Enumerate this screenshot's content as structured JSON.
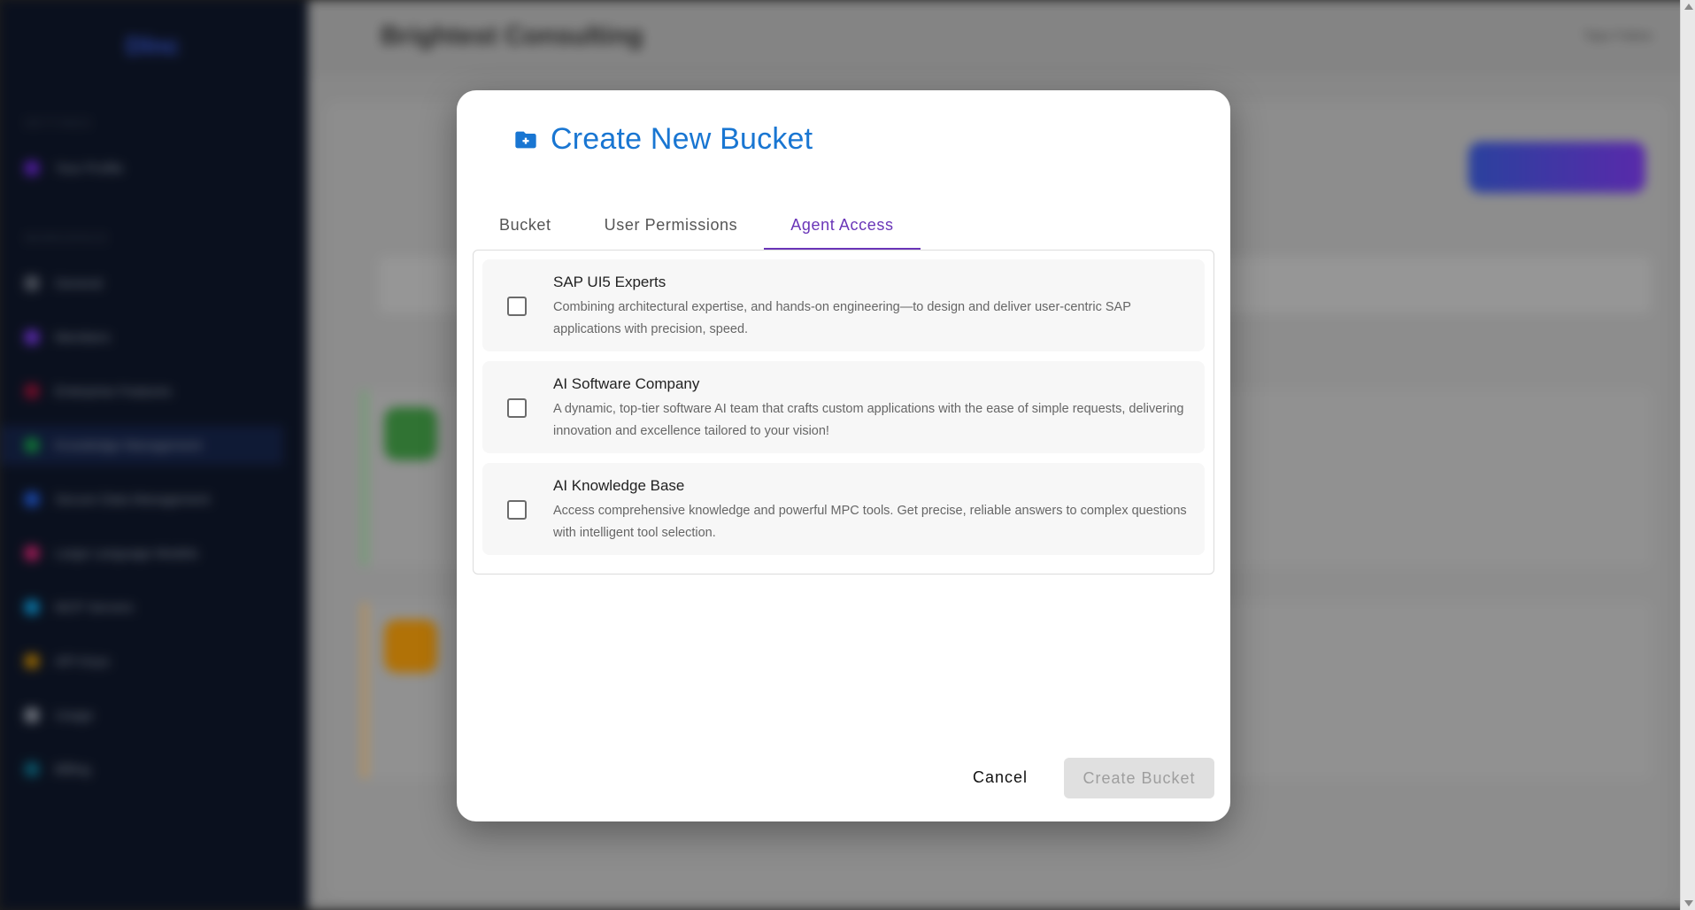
{
  "background": {
    "app_title": "Brightest Consulting",
    "logo": "Dlnc",
    "user": "Tapo Fabes",
    "sidebar_sections": [
      "SETTINGS",
      "WORKSPACE"
    ],
    "sidebar_items": [
      "Your Profile",
      "General",
      "Members",
      "Enterprise Features",
      "Knowledge Management",
      "Secure Data Management",
      "Large Language Models",
      "MCP Servers",
      "API Keys",
      "Usage",
      "Billing"
    ]
  },
  "dialog": {
    "title": "Create New Bucket",
    "icon": "folder-plus-icon",
    "tabs": [
      {
        "label": "Bucket",
        "active": false
      },
      {
        "label": "User Permissions",
        "active": false
      },
      {
        "label": "Agent Access",
        "active": true
      }
    ],
    "agents": [
      {
        "name": "SAP UI5 Experts",
        "description": "Combining architectural expertise, and hands-on engineering—to design and deliver user-centric SAP applications with precision, speed.",
        "checked": false
      },
      {
        "name": "AI Software Company",
        "description": "A dynamic, top-tier software AI team that crafts custom applications with the ease of simple requests, delivering innovation and excellence tailored to your vision!",
        "checked": false
      },
      {
        "name": "AI Knowledge Base",
        "description": "Access comprehensive knowledge and powerful MPC tools. Get precise, reliable answers to complex questions with intelligent tool selection.",
        "checked": false
      }
    ],
    "cancel_label": "Cancel",
    "create_label": "Create Bucket"
  },
  "colors": {
    "title_blue": "#1976d2",
    "tab_active": "#6a35b8",
    "disabled_bg": "#e0e0e0"
  }
}
